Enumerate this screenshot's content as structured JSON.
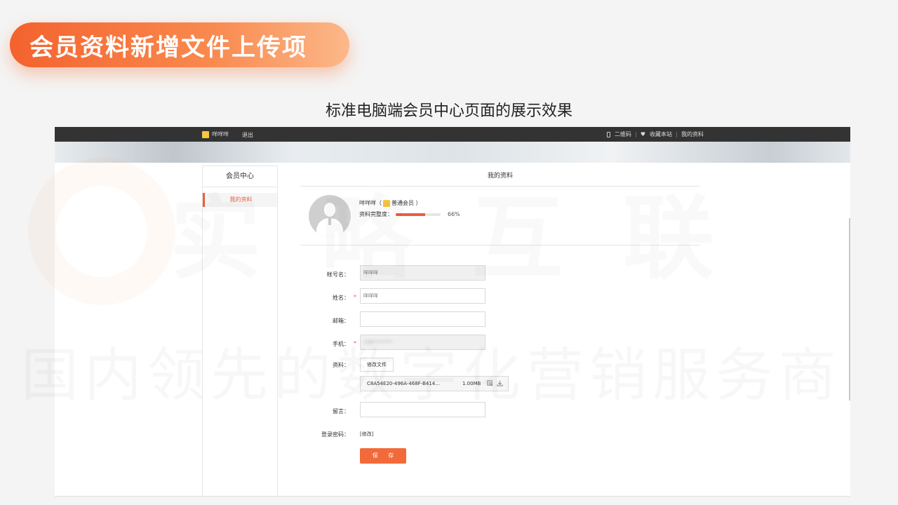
{
  "slide": {
    "header": "会员资料新增文件上传项",
    "subtitle": "标准电脑端会员中心页面的展示效果",
    "watermark_line1": "实 略 互 联",
    "watermark_line2": "国内领先的数字化营销服务商"
  },
  "topbar": {
    "username": "咩咩咩",
    "logout": "退出",
    "qrcode": "二维码",
    "favorite": "收藏本站",
    "my_profile": "我的资料"
  },
  "sidebar": {
    "title": "会员中心",
    "items": [
      {
        "label": "我的资料"
      }
    ]
  },
  "main": {
    "title": "我的资料",
    "profile": {
      "name": "咩咩咩（",
      "level": "普通会员 ）",
      "completeness_label": "资料完整度：",
      "completeness_value": 0.66,
      "completeness_text": "66%"
    },
    "form": {
      "account_label": "帐号名：",
      "account_value": "咩咩咩",
      "name_label": "姓名：",
      "name_value": "咩咩咩",
      "required_mark": "*",
      "email_label": "邮箱：",
      "email_value": "",
      "phone_label": "手机：",
      "phone_value": "138********",
      "file_label": "资料：",
      "file_button": "修改文件",
      "file_name": "C8A54E20-496A-468F-B414...",
      "file_size": "1.00MB",
      "message_label": "留言：",
      "message_value": "",
      "password_label": "登录密码：",
      "password_link": "[修改]",
      "save_button": "保 存"
    }
  },
  "colors": {
    "accent": "#e8603c",
    "topbar": "#333333",
    "pill_start": "#f4622e",
    "pill_end": "#fcb88a"
  }
}
